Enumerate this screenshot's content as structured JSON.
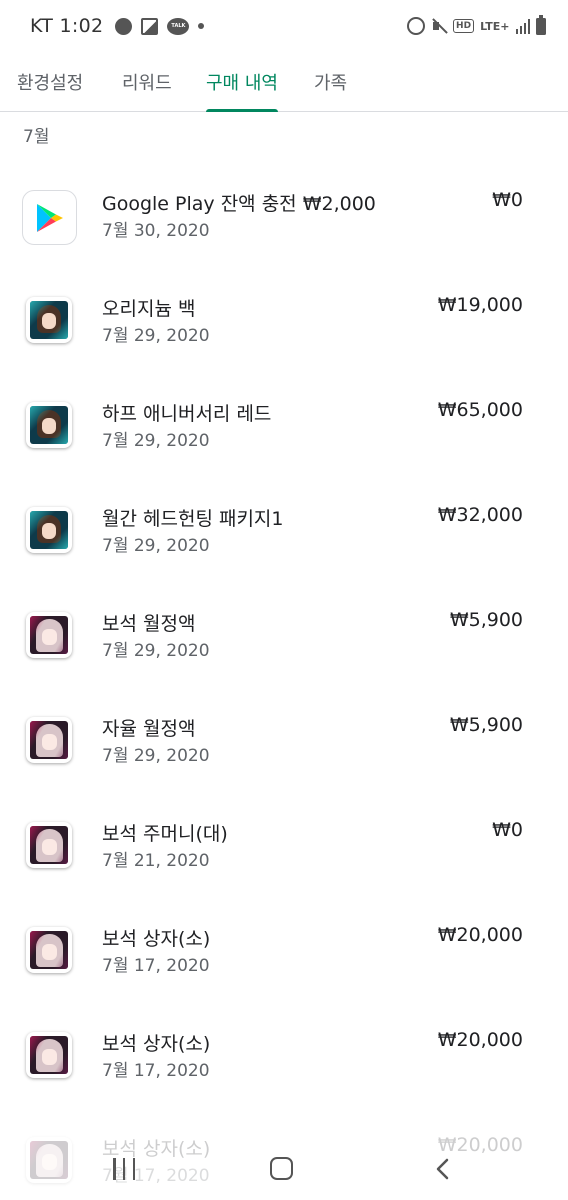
{
  "status_bar": {
    "carrier_time": "KT 1:02",
    "talk_label": "TALK",
    "hd_label": "HD",
    "lte_label": "LTE+"
  },
  "tabs": [
    {
      "label": "환경설정",
      "active": false
    },
    {
      "label": "리워드",
      "active": false
    },
    {
      "label": "구매 내역",
      "active": true
    },
    {
      "label": "가족",
      "active": false
    }
  ],
  "accent_color": "#01875f",
  "section": {
    "month": "7월"
  },
  "purchases": [
    {
      "title": "Google Play 잔액 충전 ₩2,000",
      "date": "7월 30, 2020",
      "price": "₩0",
      "icon": "google-play-icon"
    },
    {
      "title": "오리지늄 백",
      "date": "7월 29, 2020",
      "price": "₩19,000",
      "icon": "arknights-app-icon"
    },
    {
      "title": "하프 애니버서리 레드",
      "date": "7월 29, 2020",
      "price": "₩65,000",
      "icon": "arknights-app-icon"
    },
    {
      "title": "월간 헤드헌팅 패키지1",
      "date": "7월 29, 2020",
      "price": "₩32,000",
      "icon": "arknights-app-icon"
    },
    {
      "title": "보석 월정액",
      "date": "7월 29, 2020",
      "price": "₩5,900",
      "icon": "anime-game-app-icon"
    },
    {
      "title": "자율 월정액",
      "date": "7월 29, 2020",
      "price": "₩5,900",
      "icon": "anime-game-app-icon"
    },
    {
      "title": "보석 주머니(대)",
      "date": "7월 21, 2020",
      "price": "₩0",
      "icon": "anime-game-app-icon"
    },
    {
      "title": "보석 상자(소)",
      "date": "7월 17, 2020",
      "price": "₩20,000",
      "icon": "anime-game-app-icon"
    },
    {
      "title": "보석 상자(소)",
      "date": "7월 17, 2020",
      "price": "₩20,000",
      "icon": "anime-game-app-icon"
    },
    {
      "title": "보석 상자(소)",
      "date": "7월 17, 2020",
      "price": "₩20,000",
      "icon": "anime-game-app-icon"
    }
  ],
  "nav_bar": {
    "recent_icon": "recent-apps-icon",
    "home_icon": "home-icon",
    "back_icon": "back-icon"
  }
}
